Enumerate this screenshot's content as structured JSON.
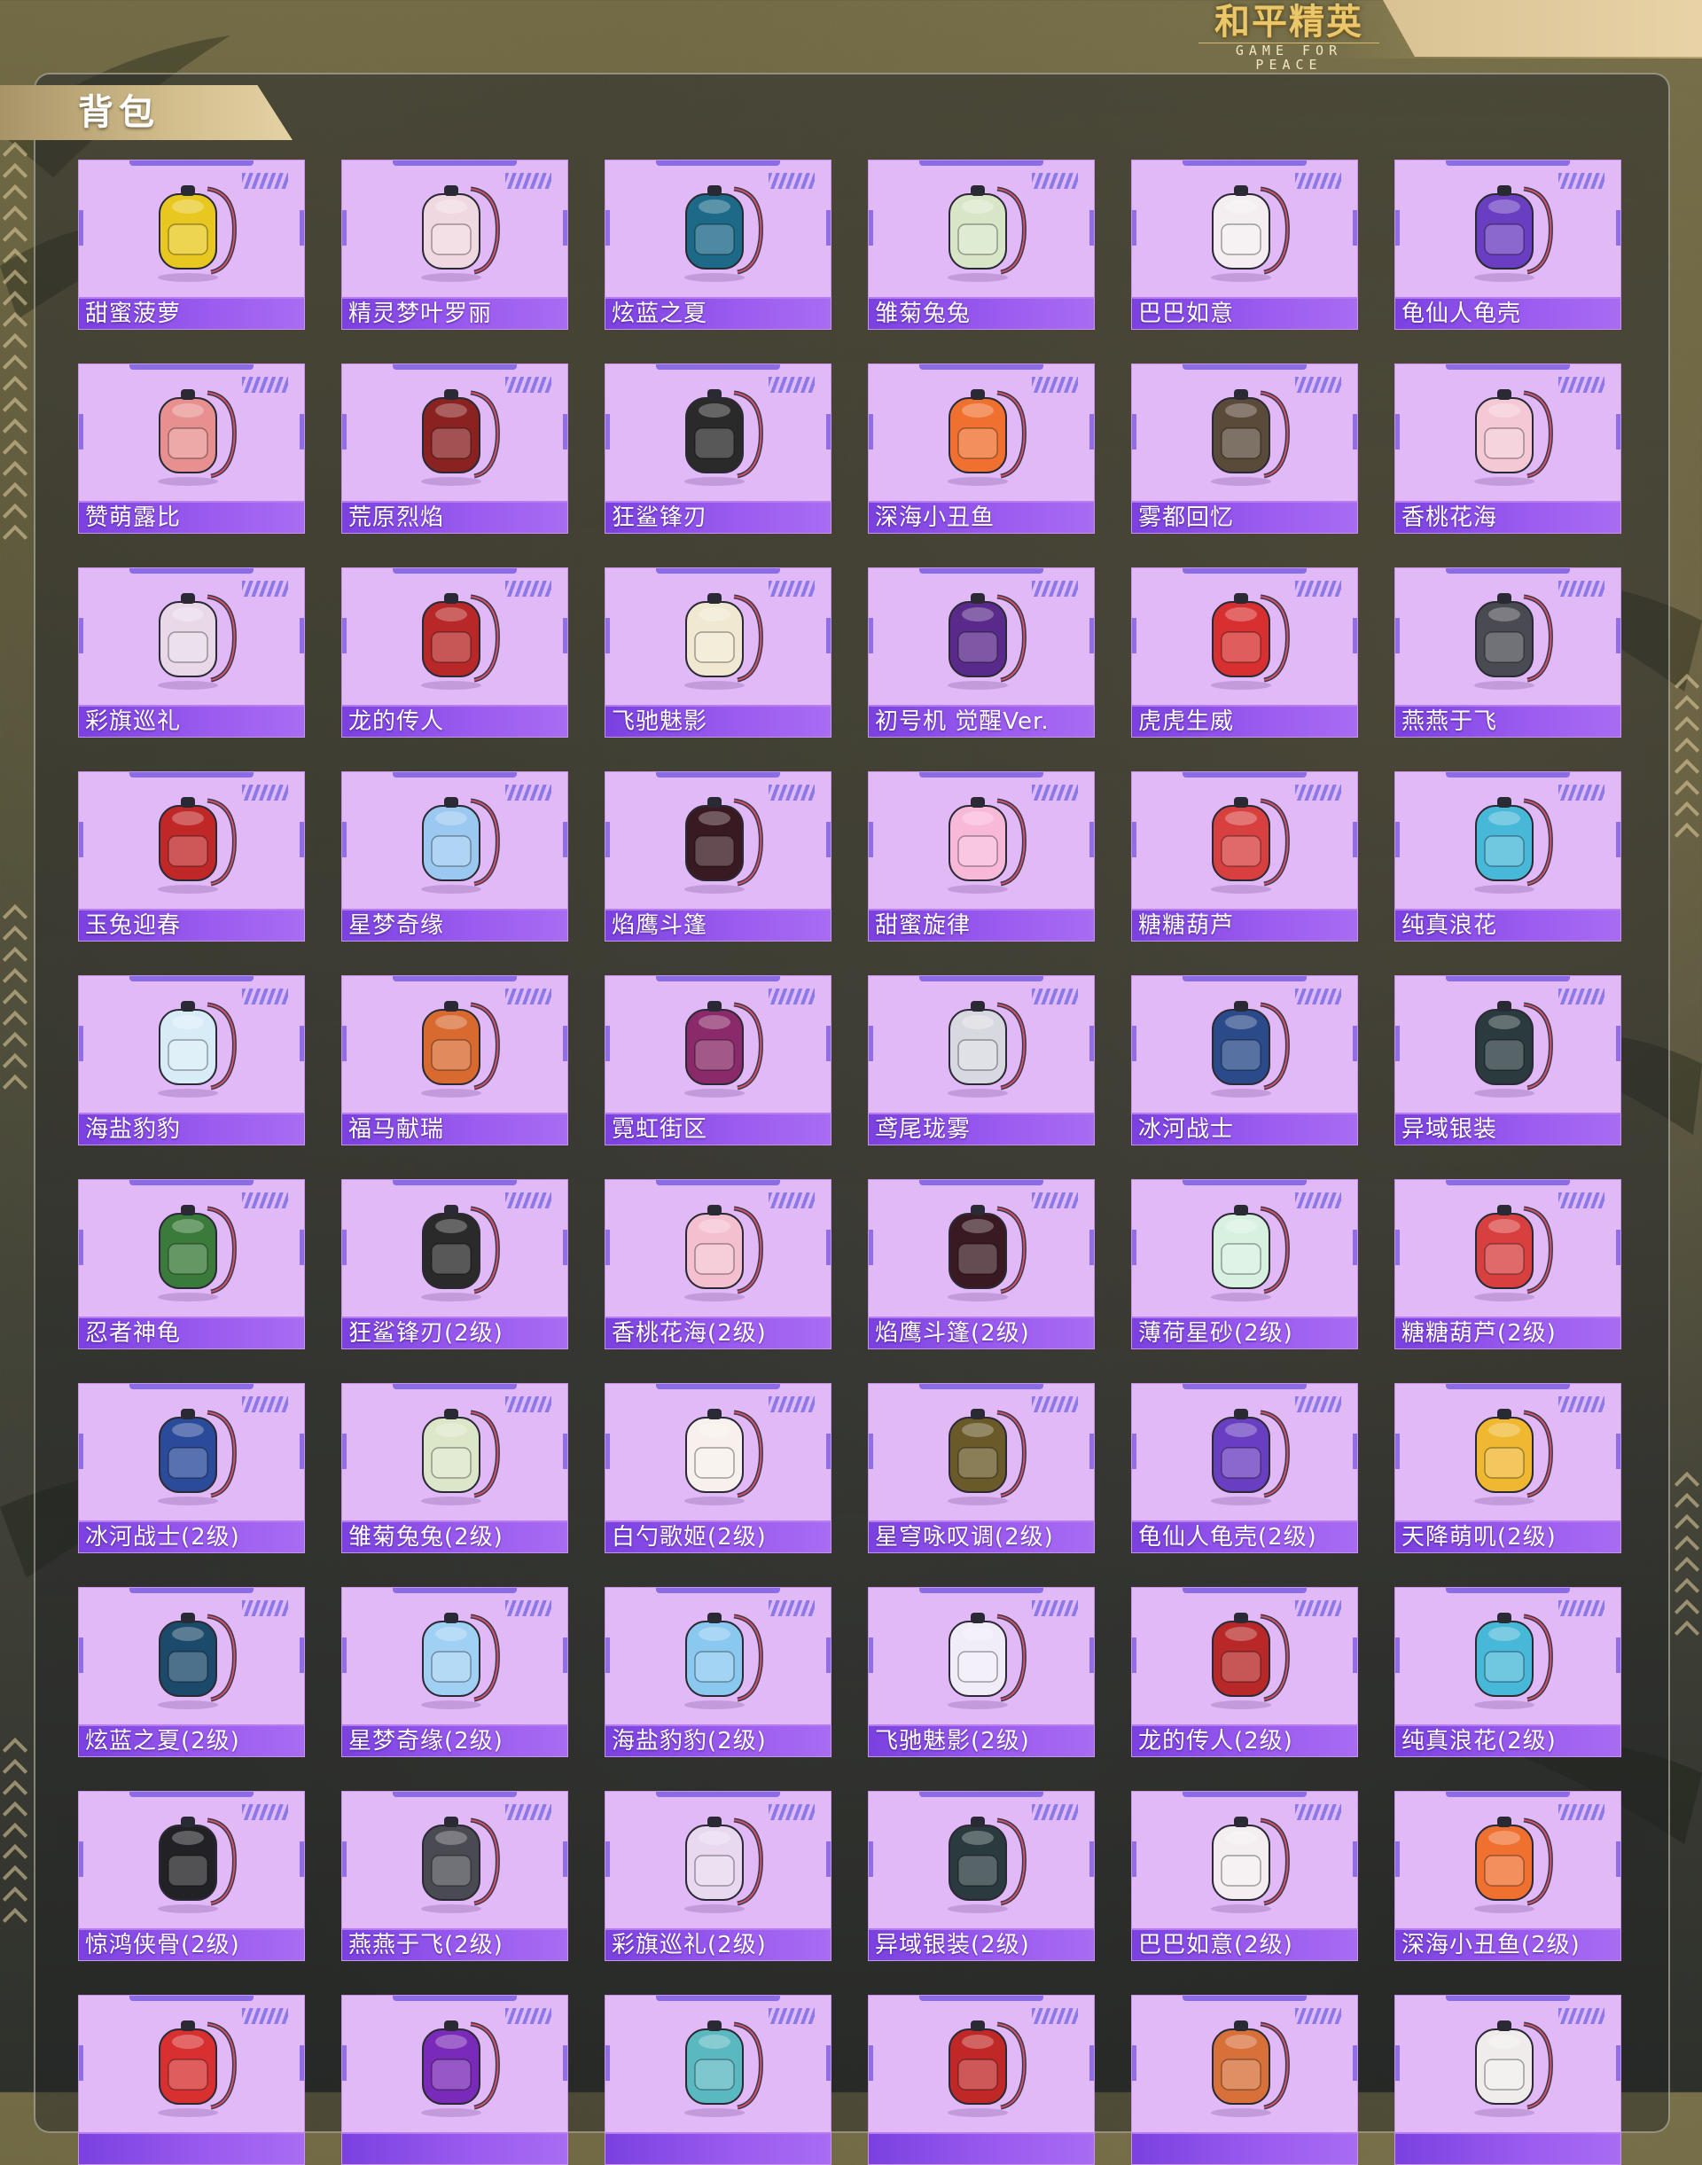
{
  "brand": {
    "logo_cn": "和平精英",
    "logo_en": "GAME FOR PEACE"
  },
  "page": {
    "title": "背包"
  },
  "colors": {
    "card_bg": "#e2b9f7",
    "label_bg": "#8a4fe8",
    "accent": "#8a6de6",
    "gold": "#d3be8d"
  },
  "items": [
    {
      "name": "甜蜜菠萝",
      "icon": "backpack-icon",
      "color": "#e8c820"
    },
    {
      "name": "精灵梦叶罗丽",
      "icon": "backpack-icon",
      "color": "#f0d8e0"
    },
    {
      "name": "炫蓝之夏",
      "icon": "backpack-icon",
      "color": "#1c6a88"
    },
    {
      "name": "雏菊兔兔",
      "icon": "backpack-icon",
      "color": "#d8e6c8"
    },
    {
      "name": "巴巴如意",
      "icon": "backpack-icon",
      "color": "#f4eef0"
    },
    {
      "name": "龟仙人龟壳",
      "icon": "backpack-icon",
      "color": "#6a3ec0"
    },
    {
      "name": "赞萌露比",
      "icon": "backpack-icon",
      "color": "#e89090"
    },
    {
      "name": "荒原烈焰",
      "icon": "backpack-icon",
      "color": "#8a2222"
    },
    {
      "name": "狂鲨锋刃",
      "icon": "backpack-icon",
      "color": "#2a2a2a"
    },
    {
      "name": "深海小丑鱼",
      "icon": "backpack-icon",
      "color": "#f07030"
    },
    {
      "name": "雾都回忆",
      "icon": "backpack-icon",
      "color": "#5a4a3a"
    },
    {
      "name": "香桃花海",
      "icon": "backpack-icon",
      "color": "#f4c8d4"
    },
    {
      "name": "彩旗巡礼",
      "icon": "backpack-icon",
      "color": "#e8d8e8"
    },
    {
      "name": "龙的传人",
      "icon": "backpack-icon",
      "color": "#b82828"
    },
    {
      "name": "飞驰魅影",
      "icon": "backpack-icon",
      "color": "#f0e8d0"
    },
    {
      "name": "初号机 觉醒Ver.",
      "icon": "backpack-icon",
      "color": "#5a2a8a"
    },
    {
      "name": "虎虎生威",
      "icon": "backpack-icon",
      "color": "#d83030"
    },
    {
      "name": "燕燕于飞",
      "icon": "backpack-icon",
      "color": "#4a4a52"
    },
    {
      "name": "玉兔迎春",
      "icon": "backpack-icon",
      "color": "#c02828"
    },
    {
      "name": "星梦奇缘",
      "icon": "backpack-icon",
      "color": "#9ac8f0"
    },
    {
      "name": "焰鹰斗篷",
      "icon": "backpack-icon",
      "color": "#3a1a22"
    },
    {
      "name": "甜蜜旋律",
      "icon": "backpack-icon",
      "color": "#f8b8d8"
    },
    {
      "name": "糖糖葫芦",
      "icon": "backpack-icon",
      "color": "#d84040"
    },
    {
      "name": "纯真浪花",
      "icon": "backpack-icon",
      "color": "#48b8d8"
    },
    {
      "name": "海盐豹豹",
      "icon": "backpack-icon",
      "color": "#d8ecf8"
    },
    {
      "name": "福马献瑞",
      "icon": "backpack-icon",
      "color": "#d86a30"
    },
    {
      "name": "霓虹街区",
      "icon": "backpack-icon",
      "color": "#8a2a6a"
    },
    {
      "name": "鸢尾珑雾",
      "icon": "backpack-icon",
      "color": "#d8d8e0"
    },
    {
      "name": "冰河战士",
      "icon": "backpack-icon",
      "color": "#2a4a8a"
    },
    {
      "name": "异域银装",
      "icon": "backpack-icon",
      "color": "#2a3a3e"
    },
    {
      "name": "忍者神龟",
      "icon": "backpack-icon",
      "color": "#3a7a3a"
    },
    {
      "name": "狂鲨锋刃(2级)",
      "icon": "backpack-icon",
      "color": "#2a2a2a"
    },
    {
      "name": "香桃花海(2级)",
      "icon": "backpack-icon",
      "color": "#f4c0d0"
    },
    {
      "name": "焰鹰斗篷(2级)",
      "icon": "backpack-icon",
      "color": "#3a1a22"
    },
    {
      "name": "薄荷星砂(2级)",
      "icon": "backpack-icon",
      "color": "#d8f0e0"
    },
    {
      "name": "糖糖葫芦(2级)",
      "icon": "backpack-icon",
      "color": "#d84040"
    },
    {
      "name": "冰河战士(2级)",
      "icon": "backpack-icon",
      "color": "#2a4a9a"
    },
    {
      "name": "雏菊兔兔(2级)",
      "icon": "backpack-icon",
      "color": "#dce6c8"
    },
    {
      "name": "白勺歌姬(2级)",
      "icon": "backpack-icon",
      "color": "#f8f0ec"
    },
    {
      "name": "星穹咏叹调(2级)",
      "icon": "backpack-icon",
      "color": "#6a5a2a"
    },
    {
      "name": "龟仙人龟壳(2级)",
      "icon": "backpack-icon",
      "color": "#6a3ec0"
    },
    {
      "name": "天降萌叽(2级)",
      "icon": "backpack-icon",
      "color": "#f0b830"
    },
    {
      "name": "炫蓝之夏(2级)",
      "icon": "backpack-icon",
      "color": "#1c4a6a"
    },
    {
      "name": "星梦奇缘(2级)",
      "icon": "backpack-icon",
      "color": "#a0d0f4"
    },
    {
      "name": "海盐豹豹(2级)",
      "icon": "backpack-icon",
      "color": "#8ac8f0"
    },
    {
      "name": "飞驰魅影(2级)",
      "icon": "backpack-icon",
      "color": "#f0ecf8"
    },
    {
      "name": "龙的传人(2级)",
      "icon": "backpack-icon",
      "color": "#b82828"
    },
    {
      "name": "纯真浪花(2级)",
      "icon": "backpack-icon",
      "color": "#48b8d8"
    },
    {
      "name": "惊鸿侠骨(2级)",
      "icon": "backpack-icon",
      "color": "#222226"
    },
    {
      "name": "燕燕于飞(2级)",
      "icon": "backpack-icon",
      "color": "#4a4a52"
    },
    {
      "name": "彩旗巡礼(2级)",
      "icon": "backpack-icon",
      "color": "#e8d8f0"
    },
    {
      "name": "异域银装(2级)",
      "icon": "backpack-icon",
      "color": "#2a3a3e"
    },
    {
      "name": "巴巴如意(2级)",
      "icon": "backpack-icon",
      "color": "#f4eef0"
    },
    {
      "name": "深海小丑鱼(2级)",
      "icon": "backpack-icon",
      "color": "#f07030"
    },
    {
      "name": "",
      "icon": "backpack-icon",
      "color": "#d83030"
    },
    {
      "name": "",
      "icon": "backpack-icon",
      "color": "#7a2ab8"
    },
    {
      "name": "",
      "icon": "backpack-icon",
      "color": "#5ab8c0"
    },
    {
      "name": "",
      "icon": "backpack-icon",
      "color": "#c02828"
    },
    {
      "name": "",
      "icon": "backpack-icon",
      "color": "#d8703a"
    },
    {
      "name": "",
      "icon": "backpack-icon",
      "color": "#f0ecec"
    }
  ]
}
